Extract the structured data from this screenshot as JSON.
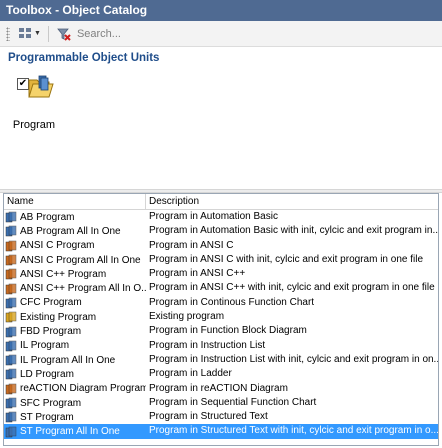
{
  "window": {
    "title": "Toolbox - Object Catalog"
  },
  "toolbar": {
    "view_icon": "view-grid-icon",
    "clear_icon": "clear-filter-icon",
    "search_placeholder": "Search..."
  },
  "catalog": {
    "group_title": "Programmable Object Units",
    "items": [
      {
        "label": "Program",
        "checked": true,
        "icon": "program-folder-icon"
      }
    ]
  },
  "list": {
    "columns": {
      "name": "Name",
      "description": "Description"
    },
    "rows": [
      {
        "name": "AB Program",
        "description": "Program in Automation Basic",
        "icon": "blue-program-icon",
        "color": "#3a6fb0",
        "selected": false
      },
      {
        "name": "AB Program All In One",
        "description": "Program in Automation Basic with init, cylcic and exit program in...",
        "icon": "blue-program-icon",
        "color": "#3a6fb0",
        "selected": false
      },
      {
        "name": "ANSI C Program",
        "description": "Program in ANSI C",
        "icon": "orange-program-icon",
        "color": "#c8691e",
        "selected": false
      },
      {
        "name": "ANSI C Program All In One",
        "description": "Program in ANSI C with init, cylcic and exit program in one file",
        "icon": "orange-program-icon",
        "color": "#c8691e",
        "selected": false
      },
      {
        "name": "ANSI C++ Program",
        "description": "Program in ANSI C++",
        "icon": "orange-program-icon",
        "color": "#c8691e",
        "selected": false
      },
      {
        "name": "ANSI C++ Program All In O...",
        "description": "Program in ANSI C++ with init, cylcic and exit program in one file",
        "icon": "orange-program-icon",
        "color": "#c8691e",
        "selected": false
      },
      {
        "name": "CFC Program",
        "description": "Program in Continous Function Chart",
        "icon": "blue-program-icon",
        "color": "#3a6fb0",
        "selected": false
      },
      {
        "name": "Existing Program",
        "description": "Existing program",
        "icon": "existing-program-icon",
        "color": "#d9a520",
        "selected": false
      },
      {
        "name": "FBD Program",
        "description": "Program in Function Block Diagram",
        "icon": "blue-program-icon",
        "color": "#3a6fb0",
        "selected": false
      },
      {
        "name": "IL Program",
        "description": "Program in Instruction List",
        "icon": "blue-program-icon",
        "color": "#3a6fb0",
        "selected": false
      },
      {
        "name": "IL Program All In One",
        "description": "Program in Instruction List with init, cylcic and exit program in on...",
        "icon": "blue-program-icon",
        "color": "#3a6fb0",
        "selected": false
      },
      {
        "name": "LD Program",
        "description": "Program in Ladder",
        "icon": "blue-program-icon",
        "color": "#3a6fb0",
        "selected": false
      },
      {
        "name": "reACTION Diagram Program",
        "description": "Program in reACTION Diagram",
        "icon": "orange-program-icon",
        "color": "#c8691e",
        "selected": false
      },
      {
        "name": "SFC Program",
        "description": "Program in Sequential Function Chart",
        "icon": "blue-program-icon",
        "color": "#3a6fb0",
        "selected": false
      },
      {
        "name": "ST Program",
        "description": "Program in Structured Text",
        "icon": "blue-program-icon",
        "color": "#3a6fb0",
        "selected": false
      },
      {
        "name": "ST Program All In One",
        "description": "Program in Structured Text with init, cylcic and exit program in o...",
        "icon": "blue-program-icon",
        "color": "#3a6fb0",
        "selected": true
      }
    ]
  },
  "colors": {
    "title_bar": "#4f6a92",
    "group_title": "#1f4d8a",
    "selection": "#3399ff"
  }
}
